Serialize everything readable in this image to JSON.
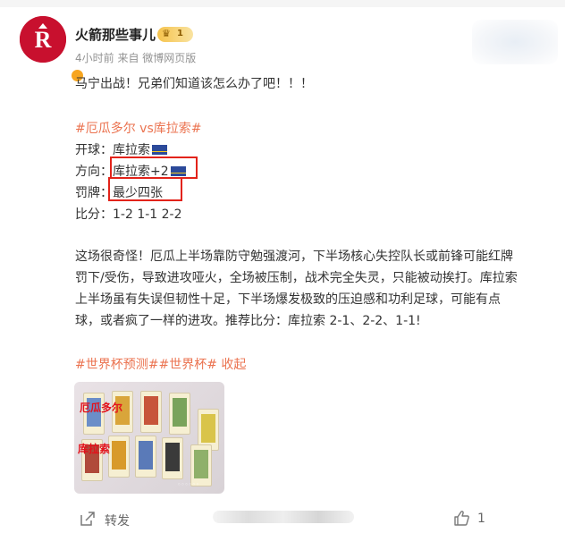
{
  "author": {
    "name": "火箭那些事儿",
    "level_badge": "1"
  },
  "meta": {
    "time": "4小时前",
    "source": "来自 微博网页版"
  },
  "post": {
    "line1": "马宁出战！兄弟们知道该怎么办了吧！！！",
    "match_tag": "#厄瓜多尔 vs库拉索#",
    "kickoff_label": "开球：",
    "kickoff_value": "库拉索",
    "direction_label": "方向：",
    "direction_value": "库拉索+2",
    "cards_label": "罚牌：",
    "cards_value": "最少四张",
    "score_label": "比分：",
    "score_value": "1-2 1-1 2-2",
    "para1": "这场很奇怪！厄瓜上半场靠防守勉强渡河，下半场核心失控队长或前锋可能红牌",
    "para2": "罚下/受伤，导致进攻哑火，全场被压制，战术完全失灵，只能被动挨打。库拉索",
    "para3": "上半场虽有失误但韧性十足，下半场爆发极致的压迫感和功利足球，可能有点",
    "para4": "球，或者疯了一样的进攻。推荐比分：库拉索 2-1、2-2、1-1!",
    "tags": "#世界杯预测##世界杯#",
    "collapse": "收起"
  },
  "image": {
    "overlay_top": "厄瓜多尔",
    "overlay_bottom": "库拉索"
  },
  "footer": {
    "repost": "转发",
    "like_count": "1"
  }
}
